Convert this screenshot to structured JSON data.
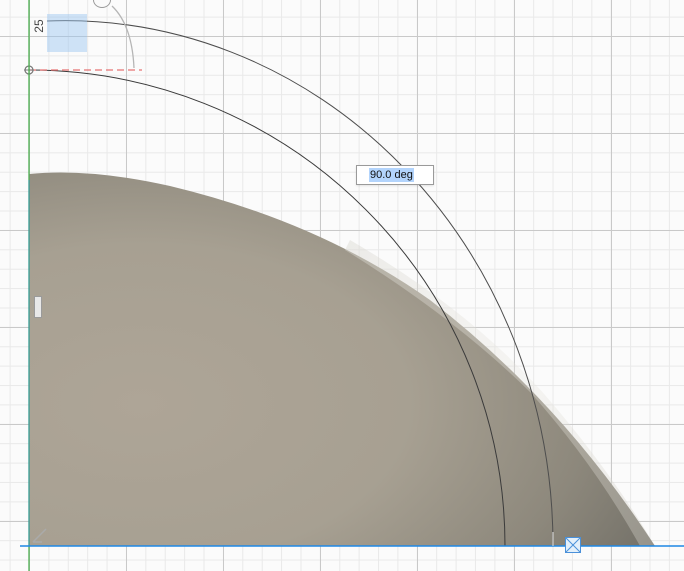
{
  "sketch": {
    "dimension_value": "25",
    "angle_input": {
      "value": "90.0 deg"
    }
  },
  "colors": {
    "axis_vertical": "#4caf50",
    "axis_horizontal": "#1e88e5",
    "profile_line": "#e57373",
    "body_surface": "#a39c8e",
    "selection": "#b3d4fc"
  }
}
